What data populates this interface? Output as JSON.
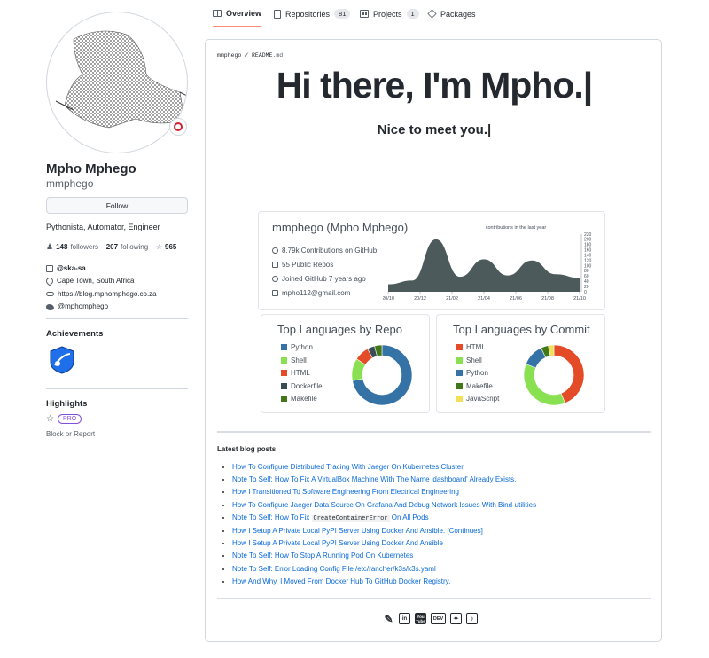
{
  "nav": {
    "overview": "Overview",
    "repositories": "Repositories",
    "repositories_count": "81",
    "projects": "Projects",
    "projects_count": "1",
    "packages": "Packages"
  },
  "profile": {
    "full_name": "Mpho Mphego",
    "username": "mmphego",
    "follow_label": "Follow",
    "bio": "Pythonista, Automator, Engineer",
    "followers_count": "148",
    "followers_label": "followers",
    "sep": "·",
    "following_count": "207",
    "following_label": "following",
    "stars": "965",
    "org": "@ska-sa",
    "location": "Cape Town, South Africa",
    "website": "https://blog.mphomphego.co.za",
    "twitter": "@mphomphego"
  },
  "sidebar": {
    "achievements": "Achievements",
    "highlights": "Highlights",
    "pro": "PRO",
    "block": "Block or Report"
  },
  "readme": {
    "path_user": "mmphego",
    "path_sep": " / ",
    "path_file": "README",
    "path_ext": ".md",
    "heading": "Hi there, I'm Mpho.|",
    "subheading": "Nice to meet you.|"
  },
  "gh_card": {
    "title": "mmphego (Mpho Mphego)",
    "contributions": "8.79k Contributions on GitHub",
    "repos": "55 Public Repos",
    "joined": "Joined GitHub 7 years ago",
    "email": "mpho112@gmail.com",
    "graph_caption": "contributions in the last year",
    "x_ticks": [
      "20/10",
      "20/12",
      "21/02",
      "21/04",
      "21/06",
      "21/08",
      "21/10"
    ],
    "y_ticks": [
      "220",
      "200",
      "180",
      "160",
      "140",
      "120",
      "100",
      "80",
      "60",
      "40",
      "20",
      "0"
    ],
    "fill": "#4c5a5b"
  },
  "chart_data": [
    {
      "type": "area",
      "title": "contributions in the last year",
      "x": [
        "20/10",
        "20/12",
        "21/02",
        "21/04",
        "21/06",
        "21/08",
        "21/10"
      ],
      "values": [
        30,
        45,
        210,
        60,
        130,
        65,
        125,
        70,
        55
      ],
      "ylim": [
        0,
        220
      ]
    },
    {
      "type": "pie",
      "title": "Top Languages by Repo",
      "labels": [
        "Python",
        "Shell",
        "HTML",
        "Dockerfile",
        "Makefile"
      ],
      "values": [
        72,
        12,
        8,
        4,
        4
      ],
      "colors": [
        "#3572A5",
        "#89e051",
        "#e34c26",
        "#384d54",
        "#427819"
      ]
    },
    {
      "type": "pie",
      "title": "Top Languages by Commit",
      "labels": [
        "HTML",
        "Shell",
        "Python",
        "Makefile",
        "JavaScript"
      ],
      "values": [
        44,
        37,
        12,
        4,
        3
      ],
      "colors": [
        "#e34c26",
        "#89e051",
        "#3572A5",
        "#427819",
        "#f1e05a"
      ]
    }
  ],
  "blog": {
    "heading": "Latest blog posts",
    "posts": [
      "How To Configure Distributed Tracing With Jaeger On Kubernetes Cluster",
      "Note To Self: How To Fix A VirtualBox Machine With The Name 'dashboard' Already Exists.",
      "How I Transitioned To Software Engineering From Electrical Engineering",
      "How To Configure Jaeger Data Source On Grafana And Debug Network Issues With Bind-utilities",
      "Note To Self: How To Fix",
      "How I Setup A Private Local PyPI Server Using Docker And Ansible. [Continues]",
      "How I Setup A Private Local PyPI Server Using Docker And Ansible",
      "Note To Self: How To Stop A Running Pod On Kubernetes",
      "Note To Self: Error Loading Config File /etc/rancher/k3s/k3s.yaml",
      "How And Why, I Moved From Docker Hub To GitHub Docker Registry."
    ],
    "post5_code": "CreateContainerError",
    "post5_tail": " On All Pods"
  },
  "social": {
    "youtube": "You Tube",
    "dev": "DEV"
  }
}
